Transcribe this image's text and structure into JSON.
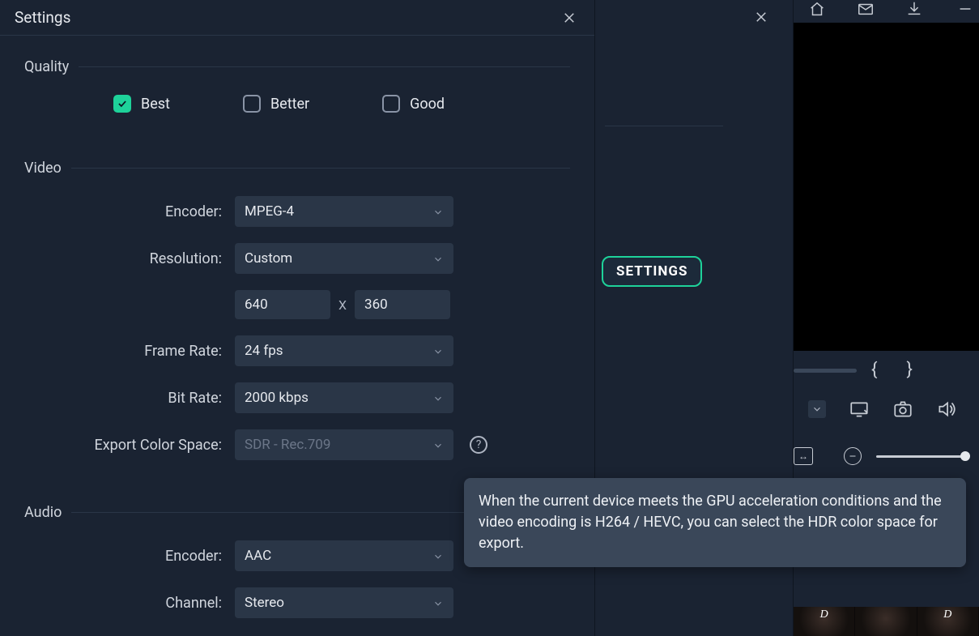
{
  "panel": {
    "title": "Settings",
    "quality": {
      "label": "Quality",
      "options": {
        "best": "Best",
        "better": "Better",
        "good": "Good"
      },
      "selected": "best"
    },
    "video": {
      "label": "Video",
      "encoder_label": "Encoder:",
      "encoder_value": "MPEG-4",
      "resolution_label": "Resolution:",
      "resolution_value": "Custom",
      "width": "640",
      "height": "360",
      "dim_separator": "X",
      "framerate_label": "Frame Rate:",
      "framerate_value": "24 fps",
      "bitrate_label": "Bit Rate:",
      "bitrate_value": "2000 kbps",
      "colorspace_label": "Export Color Space:",
      "colorspace_value": "SDR - Rec.709"
    },
    "audio": {
      "label": "Audio",
      "encoder_label": "Encoder:",
      "encoder_value": "AAC",
      "channel_label": "Channel:",
      "channel_value": "Stereo"
    }
  },
  "pill_label": "SETTINGS",
  "tooltip_text": "When the current device meets the GPU acceleration conditions and the video encoding is H264 / HEVC, you can select the HDR color space for export.",
  "brackets": {
    "open": "{",
    "close": "}"
  },
  "help_mark": "?",
  "thumb_letter": "D",
  "zoom_fit_glyph": "↔"
}
